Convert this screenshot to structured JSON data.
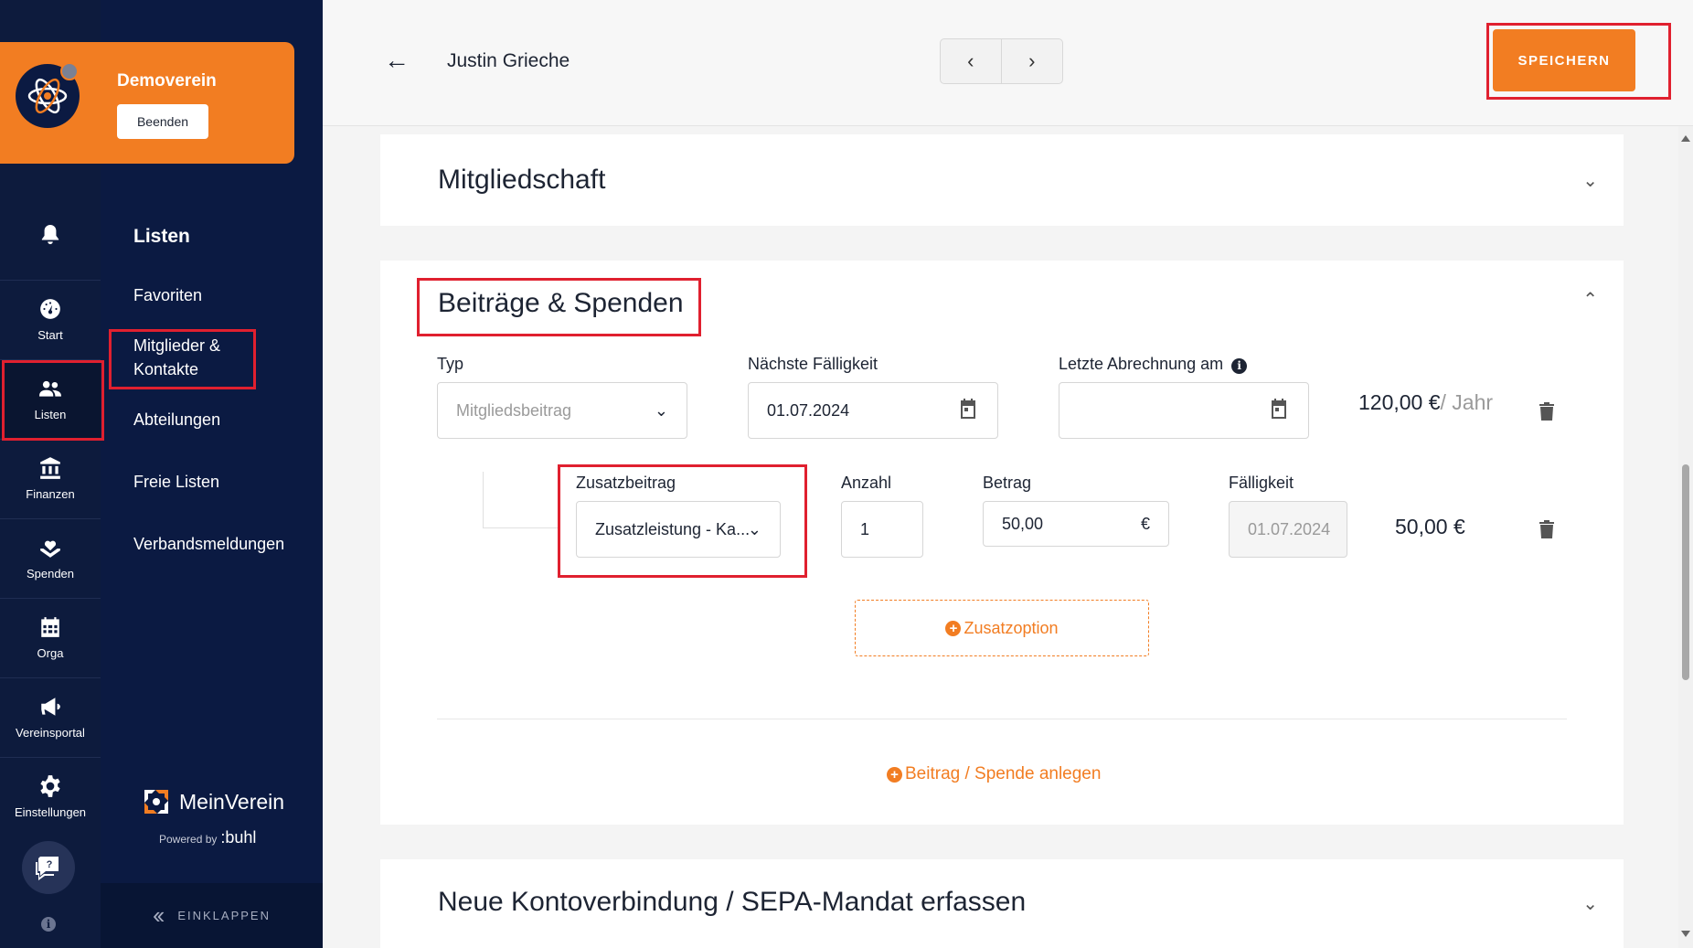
{
  "org": {
    "name": "Demoverein",
    "end_label": "Beenden"
  },
  "rail": {
    "items": [
      {
        "label": "Start",
        "icon": "speedometer-icon"
      },
      {
        "label": "Listen",
        "icon": "users-icon"
      },
      {
        "label": "Finanzen",
        "icon": "bank-icon"
      },
      {
        "label": "Spenden",
        "icon": "heart-hand-icon"
      },
      {
        "label": "Orga",
        "icon": "calendar-grid-icon"
      },
      {
        "label": "Vereinsportal",
        "icon": "megaphone-icon"
      },
      {
        "label": "Einstellungen",
        "icon": "gear-icon"
      }
    ]
  },
  "subnav": {
    "title": "Listen",
    "items": [
      "Favoriten",
      "Mitglieder & Kontakte",
      "Abteilungen",
      "Freie Listen",
      "Verbandsmeldungen"
    ],
    "brand": "MeinVerein",
    "powered_by": "Powered by",
    "powered_brand": ":buhl",
    "collapse_label": "EINKLAPPEN"
  },
  "header": {
    "member_name": "Justin Grieche",
    "save_label": "SPEICHERN"
  },
  "sections": {
    "membership": {
      "title": "Mitgliedschaft"
    },
    "contributions": {
      "title": "Beiträge & Spenden",
      "row1": {
        "type_label": "Typ",
        "type_placeholder": "Mitgliedsbeitrag",
        "due_label": "Nächste Fälligkeit",
        "due_value": "01.07.2024",
        "last_billing_label": "Letzte Abrechnung am",
        "amount": "120,00 €",
        "amount_unit": "/ Jahr"
      },
      "row2": {
        "extra_label": "Zusatzbeitrag",
        "extra_value": "Zusatzleistung - Ka...",
        "count_label": "Anzahl",
        "count_value": "1",
        "price_label": "Betrag",
        "price_value": "50,00",
        "price_currency": "€",
        "due_label": "Fälligkeit",
        "due_value": "01.07.2024",
        "amount": "50,00 €"
      },
      "add_option_label": "Zusatzoption",
      "add_contribution_label": "Beitrag / Spende anlegen"
    },
    "sepa": {
      "title": "Neue Kontoverbindung / SEPA-Mandat erfassen"
    }
  },
  "colors": {
    "accent": "#f27d22",
    "nav_bg": "#0d1b3d",
    "highlight": "#e0202f"
  }
}
